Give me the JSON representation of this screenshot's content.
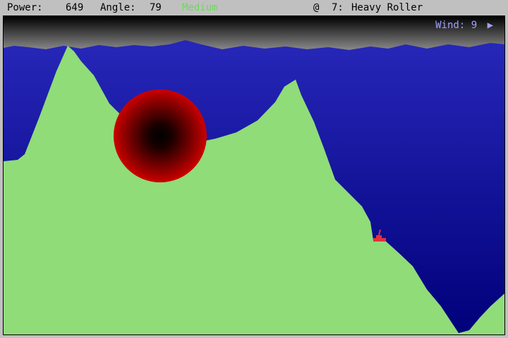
{
  "status": {
    "power_label": "Power:",
    "power_value": "649",
    "angle_label": "Angle:",
    "angle_value": "79",
    "difficulty": "Medium",
    "weapon_icon": "@",
    "weapon_slot": "7:",
    "weapon_name": "Heavy Roller"
  },
  "wind": {
    "label": "Wind:",
    "value": "9",
    "direction_icon": "triangle-right-icon"
  },
  "colors": {
    "terrain": "#90dc78",
    "sky_top": "#2a2abe",
    "sky_bottom": "#00007a",
    "explosion_outer": "#c00000",
    "explosion_core": "#000000",
    "tank": "#e03040",
    "difficulty_text": "#6adc5a"
  }
}
